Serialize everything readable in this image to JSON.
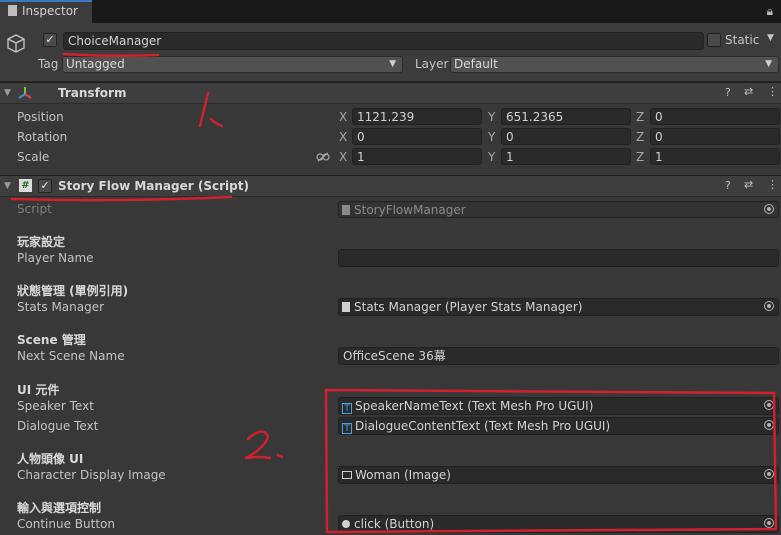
{
  "tab": {
    "title": "Inspector"
  },
  "header": {
    "object_name": "ChoiceManager",
    "static_label": "Static",
    "tag_label": "Tag",
    "tag_value": "Untagged",
    "layer_label": "Layer",
    "layer_value": "Default"
  },
  "transform": {
    "title": "Transform",
    "rows": [
      {
        "label": "Position",
        "x": "1121.239",
        "y": "651.2365",
        "z": "0"
      },
      {
        "label": "Rotation",
        "x": "0",
        "y": "0",
        "z": "0"
      },
      {
        "label": "Scale",
        "x": "1",
        "y": "1",
        "z": "1"
      }
    ],
    "axis": {
      "x": "X",
      "y": "Y",
      "z": "Z"
    }
  },
  "script_component": {
    "title": "Story Flow Manager (Script)",
    "script_label": "Script",
    "script_value": "StoryFlowManager",
    "sections": {
      "player": "玩家設定",
      "state": "狀態管理 (單例引用)",
      "scene": "Scene 管理",
      "ui": "UI 元件",
      "portrait": "人物頭像 UI",
      "input": "輸入與選項控制"
    },
    "fields": {
      "player_name_label": "Player Name",
      "player_name_value": "",
      "stats_manager_label": "Stats Manager",
      "stats_manager_value": "Stats Manager (Player Stats Manager)",
      "next_scene_label": "Next Scene Name",
      "next_scene_value": "OfficeScene 36幕",
      "speaker_text_label": "Speaker Text",
      "speaker_text_value": "SpeakerNameText (Text Mesh Pro UGUI)",
      "dialogue_text_label": "Dialogue Text",
      "dialogue_text_value": "DialogueContentText (Text Mesh Pro UGUI)",
      "char_image_label": "Character Display Image",
      "char_image_value": "Woman (Image)",
      "continue_label": "Continue Button",
      "continue_value": "click (Button)"
    }
  },
  "annotations": {
    "mark1": "1.",
    "mark2": "2."
  },
  "colors": {
    "annotation_red": "#d1202e",
    "accent_blue": "#3a79bb"
  }
}
